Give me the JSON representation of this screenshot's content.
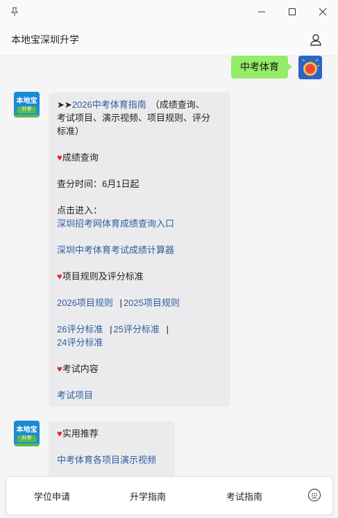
{
  "window": {
    "pin_icon": "pin-icon",
    "minimize_icon": "minimize-icon",
    "maximize_icon": "maximize-icon",
    "close_icon": "close-icon"
  },
  "header": {
    "title": "本地宝深圳升学",
    "user_icon": "user-icon"
  },
  "user_message": {
    "text": "中考体育"
  },
  "bot_avatar": {
    "top_text": "本地宝",
    "badge_text": "升学"
  },
  "bot_message_1": {
    "line1_arrows": "➤➤",
    "line1_link": "2026中考体育指南",
    "line1_rest": "（成绩查询、",
    "line2": "考试项目、演示视频、项目规则、评分",
    "line3": "标准）",
    "sec1_heading": "成绩查询",
    "query_time": "查分时间：6月1日起",
    "click_enter": "点击进入：",
    "link_score_entry": "深圳招考网体育成绩查询入口",
    "link_calculator": "深圳中考体育考试成绩计算器",
    "sec2_heading": "项目规则及评分标准",
    "link_rules_2026": "2026项目规则",
    "sep": "|",
    "link_rules_2025": "2025项目规则",
    "link_score_26": "26评分标准",
    "link_score_25": "25评分标准",
    "link_score_24": "24评分标准",
    "sec3_heading": "考试内容",
    "link_exam_items": "考试项目"
  },
  "bot_message_2": {
    "heading": "实用推荐",
    "link_videos": "中考体育各项目演示视频"
  },
  "bottom_menu": {
    "item1": "学位申请",
    "item2": "升学指南",
    "item3": "考试指南",
    "keyboard_icon": "keyboard-icon"
  },
  "colors": {
    "user_bubble": "#95ec69",
    "bot_bubble": "#ebebed",
    "link": "#2f5d9e",
    "heart": "#e1252d"
  }
}
